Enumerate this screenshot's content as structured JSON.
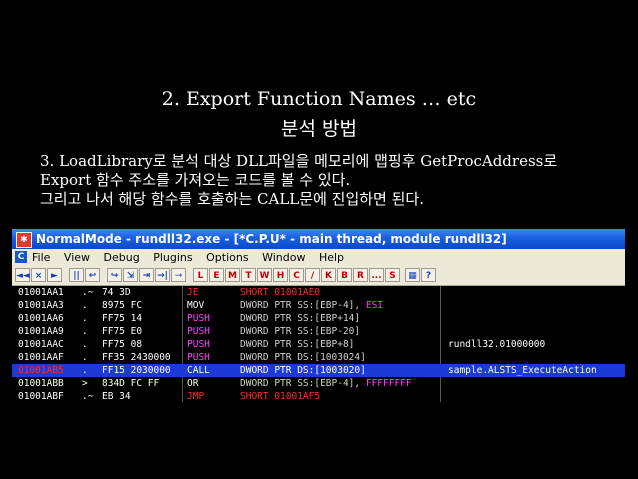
{
  "slide": {
    "title_line1": "2. Export Function Names … etc",
    "title_line2": "분석 방법",
    "desc_lines": [
      "3. LoadLibrary로 분석 대상 DLL파일을 메모리에 맵핑후 GetProcAddress로",
      "Export 함수 주소를 가져오는 코드를 볼 수 있다.",
      "그리고 나서 해당 함수를 호출하는 CALL문에 진입하면 된다."
    ]
  },
  "window": {
    "title": "NormalMode - rundll32.exe - [*C.P.U* - main thread, module rundll32]",
    "menu_icon": "C",
    "menus": [
      "File",
      "View",
      "Debug",
      "Plugins",
      "Options",
      "Window",
      "Help"
    ],
    "toolbar_left": [
      "◄◄",
      "×",
      "►",
      "||",
      "↩",
      "↪",
      "⇲",
      "⇥",
      "→|",
      "⇾"
    ],
    "toolbar_letters": [
      "L",
      "E",
      "M",
      "T",
      "W",
      "H",
      "C",
      "/",
      "K",
      "B",
      "R",
      "...",
      "S"
    ],
    "toolbar_right": [
      "▦",
      "?"
    ]
  },
  "disasm": {
    "rows": [
      {
        "addr": "01001AA1",
        "mark": ".~",
        "hex": "74 3D",
        "mnemonic": "JE",
        "operand": "SHORT 01001AE0",
        "comment": ""
      },
      {
        "addr": "01001AA3",
        "mark": ".",
        "hex": "8975 FC",
        "mnemonic": "MOV",
        "operand": "DWORD PTR SS:[EBP-4], ESI",
        "comment": ""
      },
      {
        "addr": "01001AA6",
        "mark": ".",
        "hex": "FF75 14",
        "mnemonic": "PUSH",
        "operand": "DWORD PTR SS:[EBP+14]",
        "comment": ""
      },
      {
        "addr": "01001AA9",
        "mark": ".",
        "hex": "FF75 E0",
        "mnemonic": "PUSH",
        "operand": "DWORD PTR SS:[EBP-20]",
        "comment": ""
      },
      {
        "addr": "01001AAC",
        "mark": ".",
        "hex": "FF75 08",
        "mnemonic": "PUSH",
        "operand": "DWORD PTR SS:[EBP+8]",
        "comment": "rundll32.01000000"
      },
      {
        "addr": "01001AAF",
        "mark": ".",
        "hex": "FF35 2430000",
        "mnemonic": "PUSH",
        "operand": "DWORD PTR DS:[1003024]",
        "comment": ""
      },
      {
        "addr": "01001AB5",
        "mark": ".",
        "hex": "FF15 2030000",
        "mnemonic": "CALL",
        "operand": "DWORD PTR DS:[1003020]",
        "comment": "sample.ALSTS_ExecuteAction"
      },
      {
        "addr": "01001ABB",
        "mark": ">",
        "hex": "834D FC FF",
        "mnemonic": "OR",
        "operand": "DWORD PTR SS:[EBP-4], FFFFFFFF",
        "comment": ""
      },
      {
        "addr": "01001ABF",
        "mark": ".~",
        "hex": "EB 34",
        "mnemonic": "JMP",
        "operand": "SHORT 01001AF5",
        "comment": ""
      }
    ],
    "selected_row": 6,
    "colors": {
      "addr": "#ffffff",
      "jump": "#ff2b2b",
      "push": "#ff40ff",
      "operand": "#d0d0d0",
      "selection": "#1c3ad6",
      "comment": "#ffffff"
    }
  }
}
